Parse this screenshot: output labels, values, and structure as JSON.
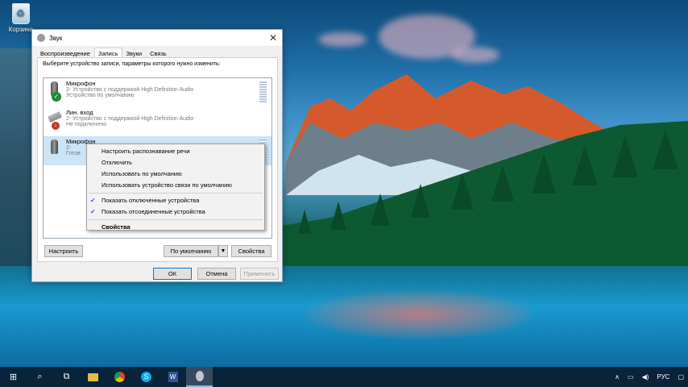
{
  "desktop": {
    "recycle_bin_label": "Корзина"
  },
  "dialog": {
    "title": "Звук",
    "tabs": [
      "Воспроизведение",
      "Запись",
      "Звуки",
      "Связь"
    ],
    "hint": "Выберите устройство записи, параметры которого нужно изменить:",
    "devices": [
      {
        "name": "Микрофон",
        "desc": "2- Устройство с поддержкой High Definition Audio",
        "status": "Устройство по умолчанию"
      },
      {
        "name": "Лин. вход",
        "desc": "2- Устройство с поддержкой High Definition Audio",
        "status": "Не подключено"
      },
      {
        "name": "Микрофон",
        "desc": "2-",
        "status": "Готов"
      }
    ],
    "buttons": {
      "configure": "Настроить",
      "set_default": "По умолчанию",
      "properties": "Свойства",
      "ok": "ОК",
      "cancel": "Отмена",
      "apply": "Применить"
    }
  },
  "context_menu": {
    "items": [
      {
        "label": "Настроить распознавание речи",
        "checked": false
      },
      {
        "label": "Отключить",
        "checked": false
      },
      {
        "label": "Использовать по умолчанию",
        "checked": false
      },
      {
        "label": "Использовать устройство связи по умолчанию",
        "checked": false
      },
      {
        "label": "Показать отключенные устройства",
        "checked": true
      },
      {
        "label": "Показать отсоединенные устройства",
        "checked": true
      },
      {
        "label": "Свойства",
        "checked": false
      }
    ]
  },
  "taskbar": {
    "language": "РУС",
    "apps": [
      "start-icon",
      "search-icon",
      "task-view-icon",
      "file-explorer-icon",
      "chrome-icon",
      "skype-icon",
      "word-icon",
      "sound-app-icon"
    ]
  }
}
